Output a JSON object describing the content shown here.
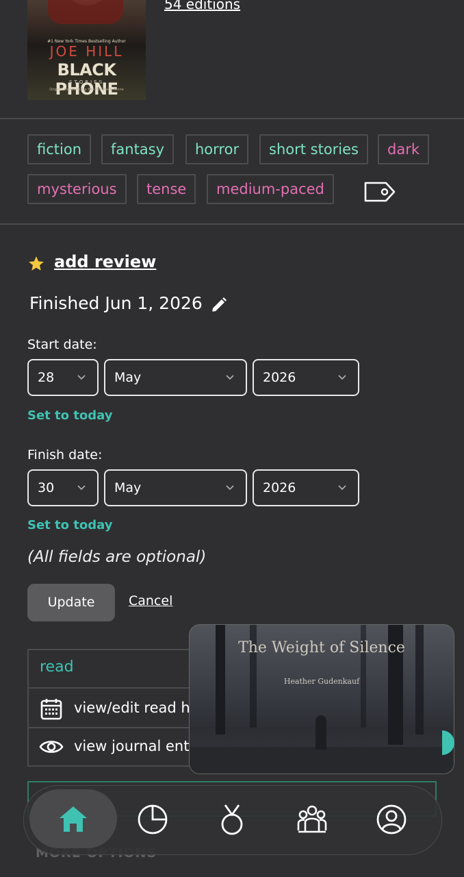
{
  "book": {
    "cover": {
      "tagline": "#1 New York Times Bestselling Author",
      "author": "JOE HILL",
      "title": "BLACK PHONE",
      "subtitle": "STORIES",
      "note": "Original stories to the film The Black Phone"
    },
    "editions_label": "54 editions"
  },
  "tags": {
    "genres": [
      "fiction",
      "fantasy",
      "horror",
      "short stories"
    ],
    "moods": [
      "dark",
      "mysterious",
      "tense",
      "medium-paced"
    ]
  },
  "review": {
    "add_review_label": "add review",
    "finished_label": "Finished Jun 1, 2026"
  },
  "start_date": {
    "label": "Start date:",
    "day": "28",
    "month": "May",
    "year": "2026",
    "set_today": "Set to today"
  },
  "finish_date": {
    "label": "Finish date:",
    "day": "30",
    "month": "May",
    "year": "2026",
    "set_today": "Set to today"
  },
  "optional_note": "(All fields are optional)",
  "actions": {
    "update_label": "Update",
    "cancel_label": "Cancel"
  },
  "shelf": {
    "status": "read",
    "view_edit_label": "view/edit read h",
    "journal_label": "view journal ent",
    "more_options": "MORE OPTIONS"
  },
  "video": {
    "title": "The Weight of Silence",
    "author": "Heather Gudenkauf"
  },
  "nav": {
    "items": [
      "home-icon",
      "stats-icon",
      "challenges-icon",
      "community-icon",
      "profile-icon"
    ],
    "accent": "#3fc2b2"
  },
  "colors": {
    "background": "#2f2f31",
    "genre_tag": "#7fe3c4",
    "mood_tag": "#e470b3",
    "accent": "#3fc2b2"
  }
}
